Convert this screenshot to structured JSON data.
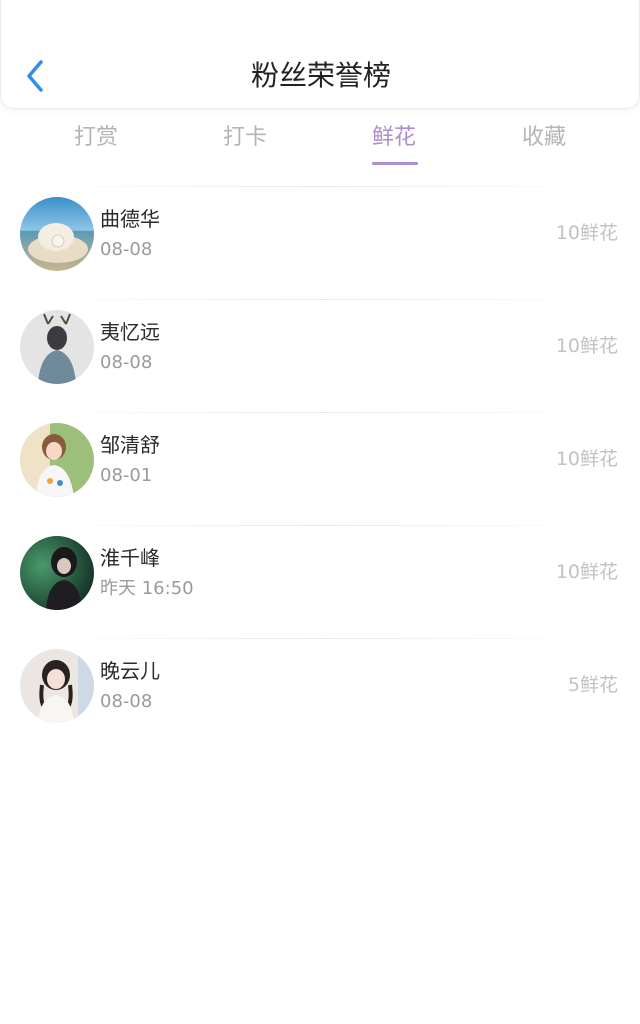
{
  "header": {
    "title": "粉丝荣誉榜",
    "back_icon": "chevron-left-icon",
    "back_color": "#2f8fe8"
  },
  "status_bar": {
    "notification_icon_count": 7
  },
  "tabs": [
    {
      "label": "打赏",
      "active": false
    },
    {
      "label": "打卡",
      "active": false
    },
    {
      "label": "鲜花",
      "active": true
    },
    {
      "label": "收藏",
      "active": false
    }
  ],
  "colors": {
    "accent": "#b08cd0",
    "tab_inactive": "#b5b5b5",
    "amount": "#c2c2c2"
  },
  "fans": [
    {
      "name": "曲德华",
      "date": "08-08",
      "amount": "10鲜花"
    },
    {
      "name": "夷忆远",
      "date": "08-08",
      "amount": "10鲜花"
    },
    {
      "name": "邹清舒",
      "date": "08-01",
      "amount": "10鲜花"
    },
    {
      "name": "淮千峰",
      "date": "昨天 16:50",
      "amount": "10鲜花"
    },
    {
      "name": "晚云儿",
      "date": "08-08",
      "amount": "5鲜花"
    }
  ]
}
